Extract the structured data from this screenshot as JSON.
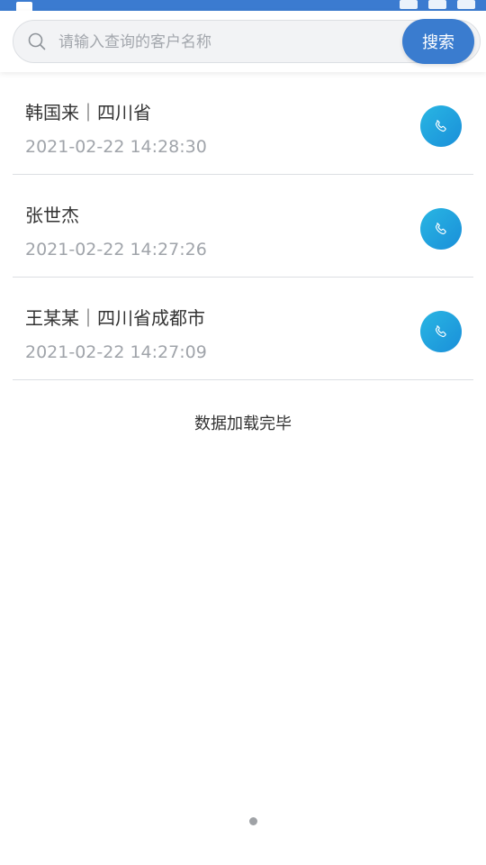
{
  "search": {
    "placeholder": "请输入查询的客户名称",
    "value": "",
    "button_label": "搜索"
  },
  "customers": [
    {
      "title": "韩国来｜四川省",
      "time": "2021-02-22 14:28:30"
    },
    {
      "title": "张世杰",
      "time": "2021-02-22 14:27:26"
    },
    {
      "title": "王某某｜四川省成都市",
      "time": "2021-02-22 14:27:09"
    }
  ],
  "footer": {
    "load_complete": "数据加载完毕"
  },
  "colors": {
    "accent": "#3a7ccf",
    "call_button": "#1fa3de",
    "status_bar": "#3b7bd0"
  },
  "icons": {
    "search": "search-icon",
    "call": "phone-icon"
  }
}
